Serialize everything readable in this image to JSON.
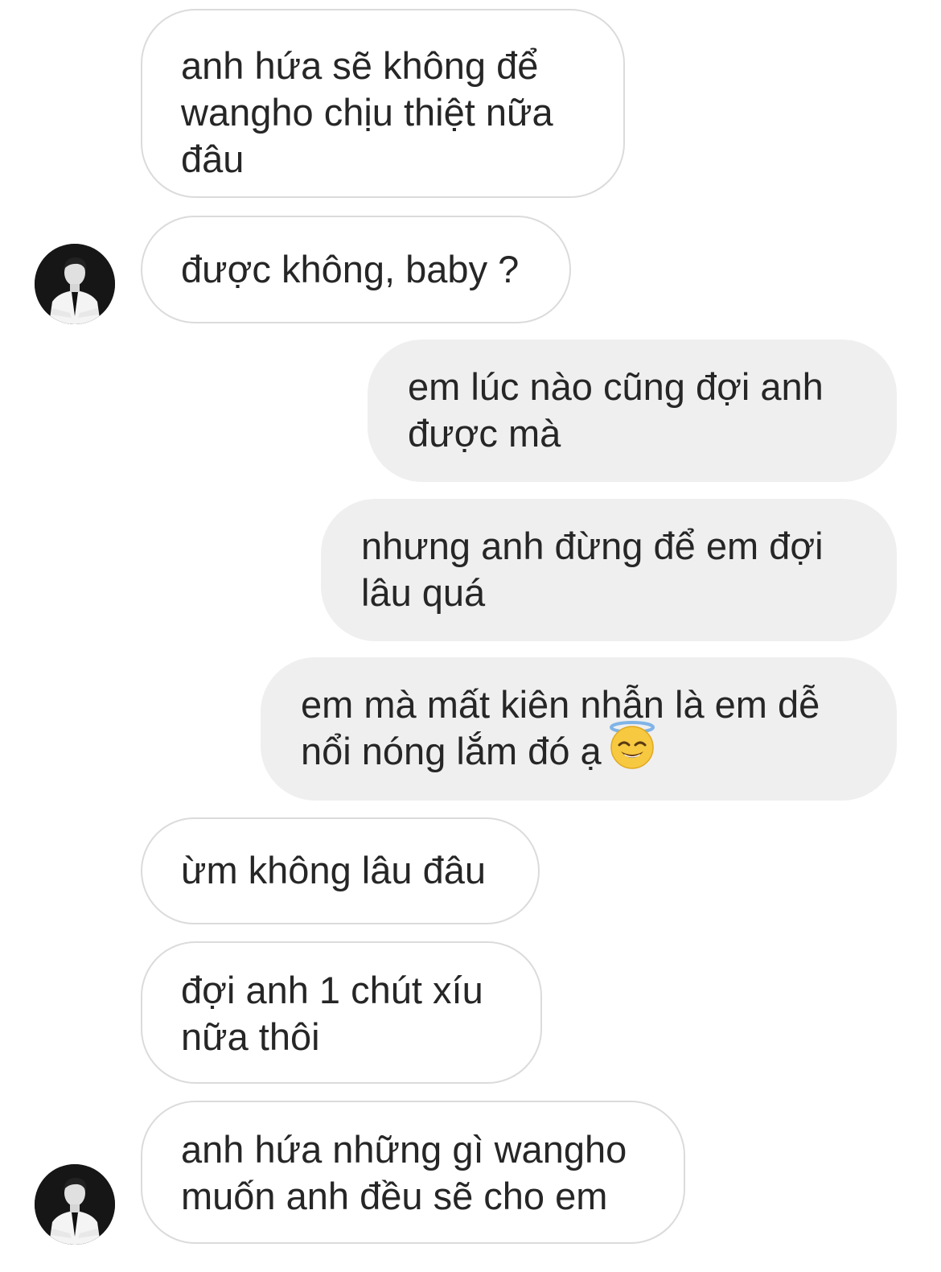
{
  "messages": [
    {
      "side": "incoming",
      "lines": [
        "anh hứa sẽ không để",
        "wangho chịu thiệt nữa",
        "đâu"
      ]
    },
    {
      "side": "incoming",
      "lines": [
        "được không, baby ?"
      ]
    },
    {
      "side": "outgoing",
      "lines": [
        "em lúc nào cũng đợi anh",
        "được mà"
      ]
    },
    {
      "side": "outgoing",
      "lines": [
        "nhưng anh đừng để em đợi",
        "lâu quá"
      ]
    },
    {
      "side": "outgoing",
      "lines": [
        "em mà mất kiên nhẫn là em dễ",
        "nổi nóng lắm đó ạ"
      ],
      "emoji": "smiling-face-with-halo"
    },
    {
      "side": "incoming",
      "lines": [
        "ừm không lâu đâu"
      ]
    },
    {
      "side": "incoming",
      "lines": [
        "đợi anh 1 chút xíu",
        "nữa thôi"
      ]
    },
    {
      "side": "incoming",
      "lines": [
        "anh hứa những gì wangho",
        "muốn anh đều sẽ cho em"
      ]
    }
  ],
  "colors": {
    "incoming_border": "#dbdbdb",
    "outgoing_bg": "#efefef",
    "text": "#262626"
  }
}
